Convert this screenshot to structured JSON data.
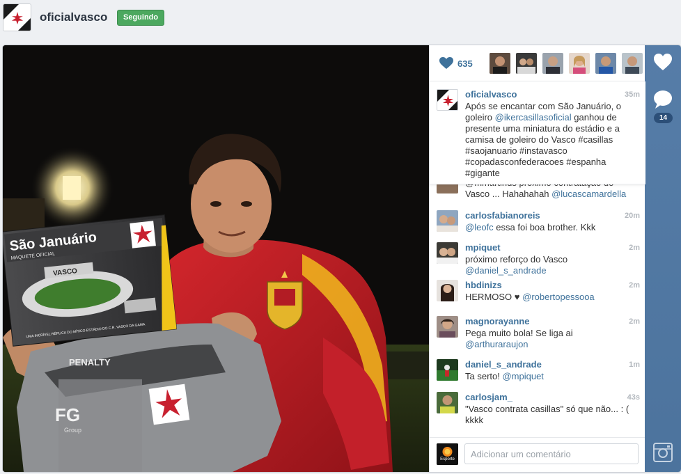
{
  "header": {
    "username": "oficialvasco",
    "follow_label": "Seguindo"
  },
  "likes": {
    "count": "635"
  },
  "caption": {
    "username": "oficialvasco",
    "time": "35m",
    "parts": [
      {
        "text": "Após se encantar com São Januário, o goleiro ",
        "mention": false
      },
      {
        "text": "@ikercasillasoficial",
        "mention": true
      },
      {
        "text": " ganhou de presente uma miniatura do estádio e a camisa de goleiro do Vasco #casillas #saojanuario #instavasco #copadasconfederacoes #espanha #gigante",
        "mention": false
      }
    ]
  },
  "partial_comment": {
    "parts": [
      {
        "text": "@mmartinds próximo contratação do Vasco ... Hahahahah ",
        "mention": false
      },
      {
        "text": "@lucascamardella",
        "mention": true
      }
    ]
  },
  "comments": [
    {
      "username": "carlosfabianoreis",
      "time": "20m",
      "parts": [
        {
          "text": "@leofc",
          "mention": true
        },
        {
          "text": " essa foi boa brother. Kkk",
          "mention": false
        }
      ]
    },
    {
      "username": "mpiquet",
      "time": "2m",
      "parts": [
        {
          "text": "próximo reforço do Vasco ",
          "mention": false
        },
        {
          "text": "@daniel_s_andrade",
          "mention": true
        }
      ]
    },
    {
      "username": "hbdinizs",
      "time": "2m",
      "parts": [
        {
          "text": "HERMOSO ♥ ",
          "mention": false
        },
        {
          "text": "@robertopessooa",
          "mention": true
        }
      ]
    },
    {
      "username": "magnorayanne",
      "time": "2m",
      "parts": [
        {
          "text": "Pega muito bola! Se liga ai ",
          "mention": false
        },
        {
          "text": "@arthuraraujon",
          "mention": true
        }
      ]
    },
    {
      "username": "daniel_s_andrade",
      "time": "1m",
      "parts": [
        {
          "text": "Ta serto! ",
          "mention": false
        },
        {
          "text": "@mpiquet",
          "mention": true
        }
      ]
    },
    {
      "username": "carlosjam_",
      "time": "43s",
      "parts": [
        {
          "text": "\"Vasco contrata casillas\" só que não... : ( kkkk",
          "mention": false
        }
      ]
    }
  ],
  "add_comment": {
    "placeholder": "Adicionar um comentário",
    "avatar_label": "Esporte"
  },
  "rail": {
    "comment_count": "14"
  },
  "photo": {
    "box_title": "São Januário",
    "box_subtitle": "MAQUETE OFICIAL",
    "box_tagline": "UMA INCRÍVEL RÉPLICA DO MÍTICO ESTÁDIO DO C.R. VASCO DA GAMA",
    "stadium_sign": "VASCO",
    "shirt_brand": "PENALTY",
    "shirt_sponsor": "FG",
    "shirt_sponsor_sub": "Group"
  },
  "colors": {
    "link": "#3f729b",
    "follow_green": "#4ca85f",
    "rail_blue": "#4f77a1"
  }
}
